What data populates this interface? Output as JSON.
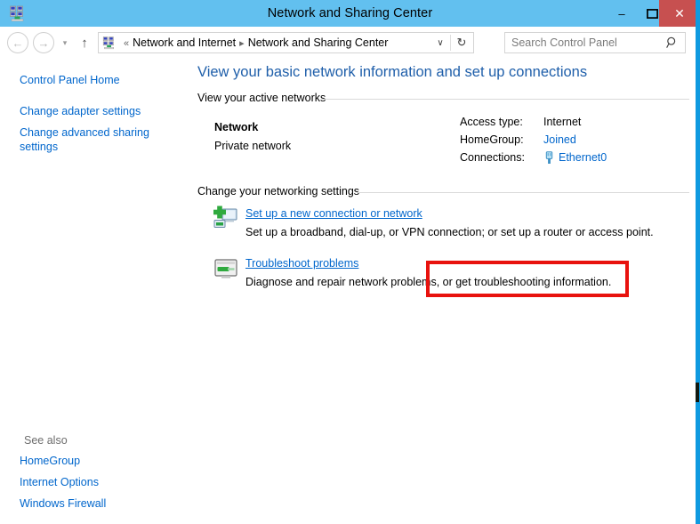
{
  "window": {
    "title": "Network and Sharing Center",
    "title_icon": "network-icon",
    "minimize_label": "–",
    "maximize_label": "❑",
    "close_label": "✕",
    "border_color": "#0f9ae0",
    "titlebar_color": "#62c0ef",
    "close_button_color": "#c75050"
  },
  "navbar": {
    "back_label": "←",
    "forward_label": "→",
    "recent_label": "▾",
    "up_label": "↑",
    "address_icon": "network-icon",
    "breadcrumb_prefix": "«",
    "breadcrumb_separator": "▸",
    "breadcrumbs": [
      "Network and Internet",
      "Network and Sharing Center"
    ],
    "dropdown_label": "∨",
    "refresh_label": "↻",
    "search_placeholder": "Search Control Panel",
    "search_value": "",
    "search_icon": "search-icon"
  },
  "sidebar": {
    "items": [
      {
        "label": "Control Panel Home"
      },
      {
        "label": "Change adapter settings"
      },
      {
        "label": "Change advanced sharing settings"
      }
    ],
    "see_also_label": "See also",
    "see_also_items": [
      {
        "label": "HomeGroup"
      },
      {
        "label": "Internet Options"
      },
      {
        "label": "Windows Firewall"
      }
    ]
  },
  "main": {
    "heading": "View your basic network information and set up connections",
    "active_networks": {
      "section_title": "View your active networks",
      "network_name": "Network",
      "network_type": "Private network",
      "details": [
        {
          "label": "Access type:",
          "value": "Internet",
          "is_link": false
        },
        {
          "label": "HomeGroup:",
          "value": "Joined",
          "is_link": true
        },
        {
          "label": "Connections:",
          "value": "Ethernet0",
          "is_link": true,
          "icon": "ethernet-plug-icon"
        }
      ]
    },
    "networking_settings": {
      "section_title": "Change your networking settings",
      "tasks": [
        {
          "icon": "new-connection-icon",
          "link": "Set up a new connection or network",
          "description": "Set up a broadband, dial-up, or VPN connection; or set up a router or access point.",
          "highlighted": true
        },
        {
          "icon": "troubleshoot-icon",
          "link": "Troubleshoot problems",
          "description": "Diagnose and repair network problems, or get troubleshooting information.",
          "highlighted": false
        }
      ]
    }
  },
  "annotation": {
    "highlight_color": "#e8120e"
  }
}
